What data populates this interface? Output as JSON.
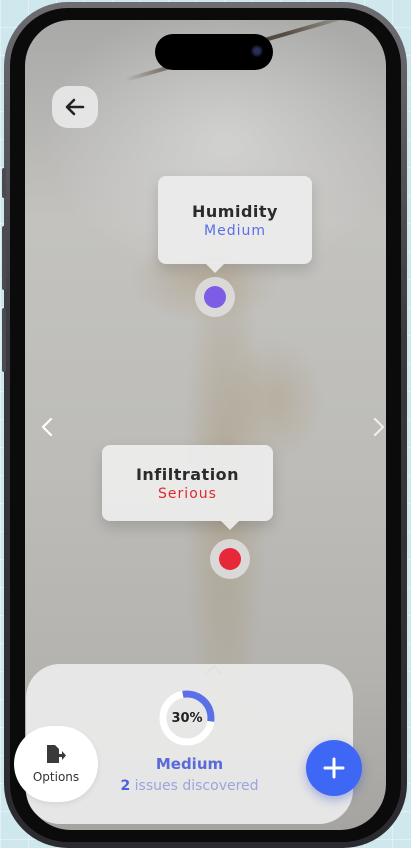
{
  "markers": [
    {
      "title": "Humidity",
      "severity": "Medium",
      "severity_color": "#5b6fe6",
      "dot_color": "#7b5de6"
    },
    {
      "title": "Infiltration",
      "severity": "Serious",
      "severity_color": "#e0282c",
      "dot_color": "#e62838"
    }
  ],
  "summary": {
    "progress_label": "30%",
    "progress_value": 30,
    "level": "Medium",
    "issues_count": "2",
    "issues_text": " issues discovered"
  },
  "options": {
    "label": "Options"
  },
  "colors": {
    "accent": "#3f67f5",
    "progress": "#5b6fe6"
  },
  "icons": [
    "back-arrow-icon",
    "chevron-left-icon",
    "chevron-right-icon",
    "chevron-up-icon",
    "export-file-icon",
    "plus-icon"
  ]
}
